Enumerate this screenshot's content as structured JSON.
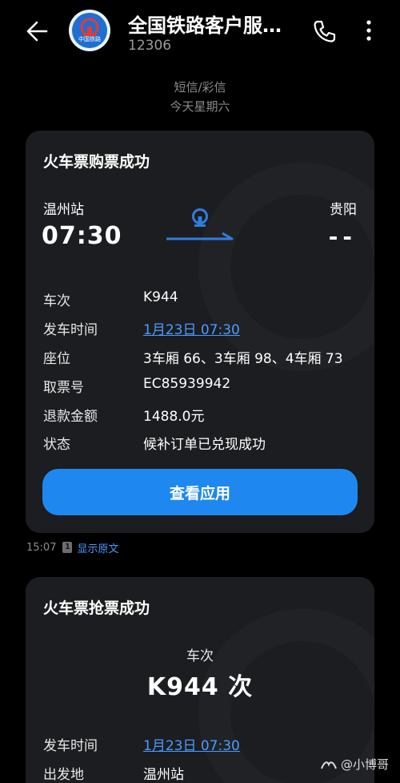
{
  "header": {
    "title": "全国铁路客户服…",
    "subtitle": "12306",
    "logo_text": "中国铁路"
  },
  "message": {
    "type": "短信/彩信",
    "date": "今天星期六"
  },
  "card1": {
    "title": "火车票购票成功",
    "from_station": "温州站",
    "from_time": "07:30",
    "to_station": "贵阳",
    "to_time": "--",
    "rows": [
      {
        "label": "车次",
        "value": "K944"
      },
      {
        "label": "发车时间",
        "value": "1月23日 07:30"
      },
      {
        "label": "座位",
        "value": "3车厢 66、3车厢 98、4车厢 73"
      },
      {
        "label": "取票号",
        "value": "EC85939942"
      },
      {
        "label": "退款金额",
        "value": "1488.0元"
      },
      {
        "label": "状态",
        "value": "候补订单已兑现成功"
      }
    ],
    "button_label": "查看应用"
  },
  "meta": {
    "time": "15:07",
    "sim": "1",
    "show_original": "显示原文"
  },
  "card2": {
    "title": "火车票抢票成功",
    "train_label": "车次",
    "train_value": "K944 次",
    "rows": [
      {
        "label": "发车时间",
        "value": "1月23日 07:30"
      },
      {
        "label": "出发地",
        "value": "温州站"
      }
    ]
  },
  "watermark": "@小博哥",
  "colors": {
    "accent": "#1e88f0",
    "link": "#4a9cff",
    "card_bg": "#1c1d20"
  }
}
